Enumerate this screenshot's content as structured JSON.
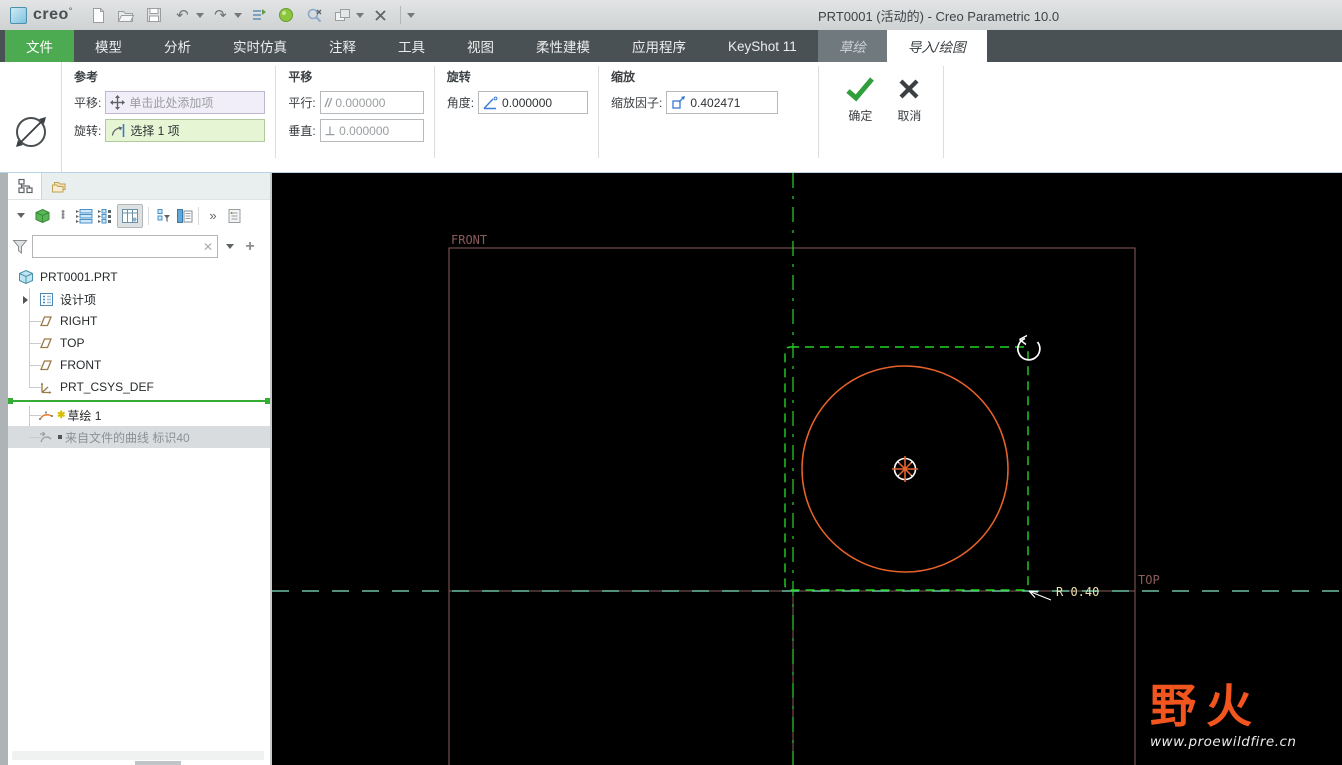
{
  "window": {
    "logo_text": "creo",
    "title": "PRT0001 (活动的) - Creo Parametric 10.0"
  },
  "tabs": [
    {
      "label": "文件"
    },
    {
      "label": "模型"
    },
    {
      "label": "分析"
    },
    {
      "label": "实时仿真"
    },
    {
      "label": "注释"
    },
    {
      "label": "工具"
    },
    {
      "label": "视图"
    },
    {
      "label": "柔性建模"
    },
    {
      "label": "应用程序"
    },
    {
      "label": "KeyShot 11"
    },
    {
      "label": "草绘"
    },
    {
      "label": "导入/绘图"
    }
  ],
  "ribbon": {
    "reference_group": {
      "title": "参考",
      "translate_label": "平移:",
      "translate_placeholder": "单击此处添加项",
      "rotate_label": "旋转:",
      "rotate_value": "选择 1 项"
    },
    "translate_group": {
      "title": "平移",
      "parallel_label": "平行:",
      "parallel_value": "0.000000",
      "vertical_label": "垂直:",
      "vertical_value": "0.000000"
    },
    "rotate_group": {
      "title": "旋转",
      "angle_label": "角度:",
      "angle_value": "0.000000"
    },
    "scale_group": {
      "title": "缩放",
      "factor_label": "缩放因子:",
      "factor_value": "0.402471"
    },
    "ok_label": "确定",
    "cancel_label": "取消"
  },
  "navigator": {
    "filter_value": "",
    "tree": {
      "root": "PRT0001.PRT",
      "design_items": "设计项",
      "right": "RIGHT",
      "top": "TOP",
      "front": "FRONT",
      "csys": "PRT_CSYS_DEF",
      "sketch": "草绘 1",
      "curve": "来自文件的曲线 标识40"
    }
  },
  "canvas": {
    "front_label": "FRONT",
    "top_label": "TOP",
    "radius_label": "R 0.40",
    "watermark_name": "野火",
    "watermark_url": "www.proewildfire.cn",
    "colors": {
      "geometry_orange": "#e8622a",
      "selection_green": "#22d422",
      "datum_maroon": "#8a5c5c",
      "centerline_teal": "#82e6c6",
      "dimension_cream": "#ece0a8"
    }
  }
}
